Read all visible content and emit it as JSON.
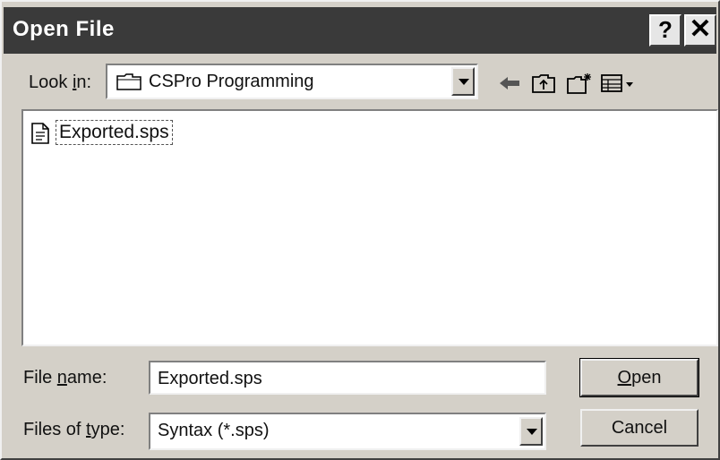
{
  "window": {
    "title": "Open File",
    "help_label": "?",
    "close_label": "✕"
  },
  "lookin": {
    "label_pre": "Look ",
    "label_accel": "i",
    "label_post": "n:",
    "value": "CSPro Programming"
  },
  "toolbar": {
    "icons": [
      "back-arrow-icon",
      "up-folder-icon",
      "new-folder-icon",
      "view-menu-icon"
    ]
  },
  "files": [
    {
      "name": "Exported.sps",
      "icon": "document-icon"
    }
  ],
  "filename": {
    "label_pre": "File ",
    "label_accel": "n",
    "label_post": "ame:",
    "value": "Exported.sps"
  },
  "filetype": {
    "label_pre": "Files of ",
    "label_accel": "t",
    "label_post": "ype:",
    "value": "Syntax (*.sps)"
  },
  "buttons": {
    "open_accel": "O",
    "open_rest": "pen",
    "cancel": "Cancel"
  }
}
